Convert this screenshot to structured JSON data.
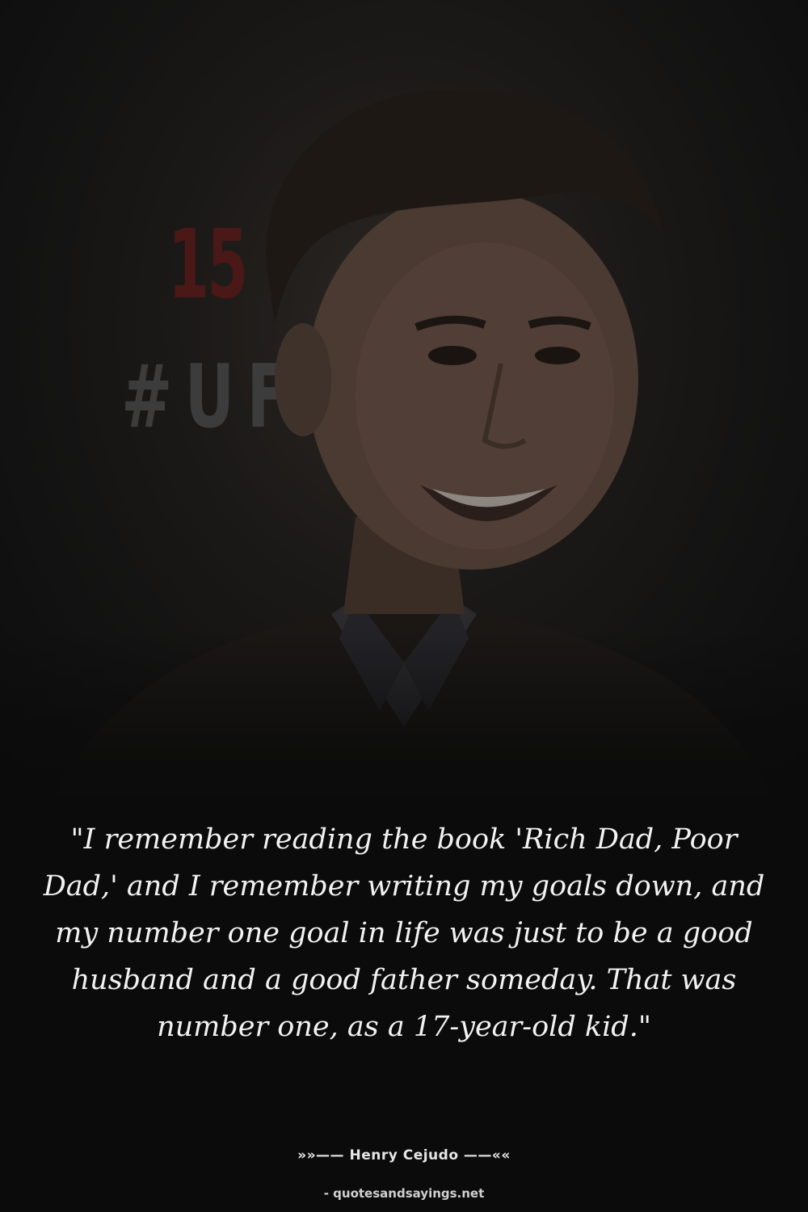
{
  "background": {
    "overlay_color": "#0b0b0b",
    "backdrop_number": "15",
    "backdrop_tag": "#UF",
    "backdrop_number_color": "#4a1816",
    "backdrop_tag_color": "#3c3c3c"
  },
  "quote": {
    "text": "\"I remember reading the book 'Rich Dad, Poor Dad,' and I remember writing my goals down, and my number one goal in life was just to be a good husband and a good father someday. That was number one, as a 17-year-old kid.\""
  },
  "attribution": {
    "text": "»»—— Henry Cejudo ——««"
  },
  "source": {
    "text": "- quotesandsayings.net"
  }
}
